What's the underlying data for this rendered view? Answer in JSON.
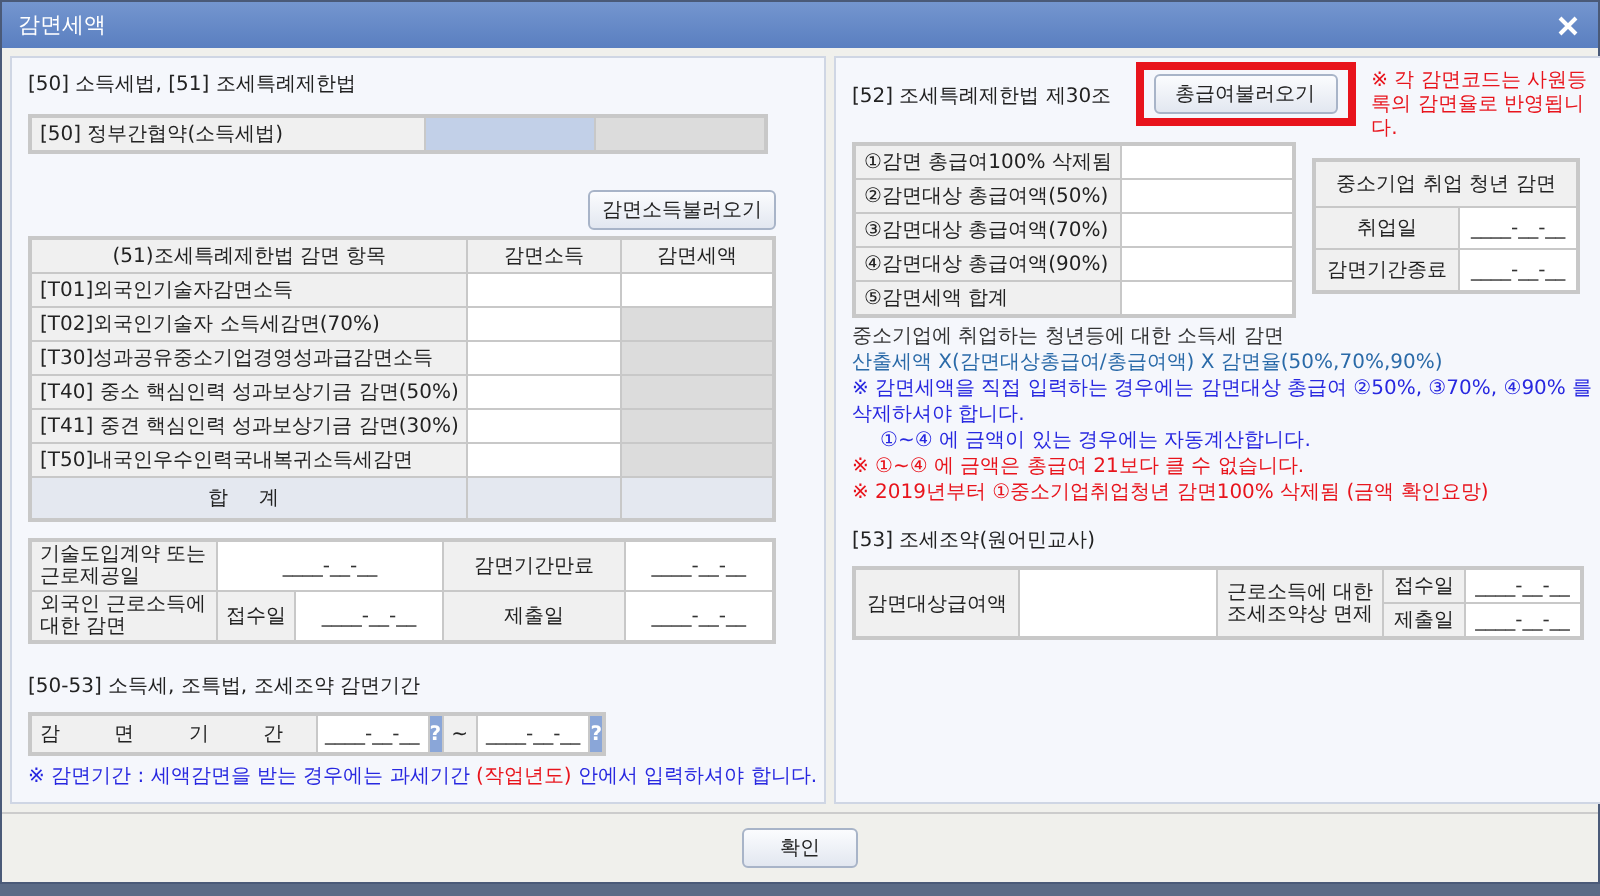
{
  "window": {
    "title": "감면세액"
  },
  "left": {
    "section_title": "[50] 소득세법, [51] 조세특례제한법",
    "treaty": {
      "label": "[50] 정부간협약(소득세법)"
    },
    "load_button": "감면소득불러오기",
    "table": {
      "columns": [
        "(51)조세특례제한법 감면 항목",
        "감면소득",
        "감면세액"
      ],
      "rows": [
        {
          "label": "[T01]외국인기술자감면소득",
          "tax_editable": true
        },
        {
          "label": "[T02]외국인기술자 소득세감면(70%)",
          "tax_editable": false
        },
        {
          "label": "[T30]성과공유중소기업경영성과급감면소득",
          "tax_editable": false
        },
        {
          "label": "[T40] 중소 핵심인력 성과보상기금 감면(50%)",
          "tax_editable": false
        },
        {
          "label": "[T41] 중견 핵심인력 성과보상기금 감면(30%)",
          "tax_editable": false
        },
        {
          "label": "[T50]내국인우수인력국내복귀소득세감면",
          "tax_editable": false
        }
      ],
      "total_label": "합 계"
    },
    "dates": {
      "contract_label": "기술도입계약 또는 근로제공일",
      "contract_date": "____-__-__",
      "expiry_label": "감면기간만료",
      "expiry_date": "____-__-__",
      "foreign_label": "외국인 근로소득에 대한 감면",
      "received_label": "접수일",
      "received_date": "____-__-__",
      "submitted_label": "제출일",
      "submitted_date": "____-__-__"
    },
    "period_title": "[50-53] 소득세, 조특법, 조세조약 감면기간",
    "period": {
      "label": "감 면 기 간",
      "from": "____-__-__",
      "help": "?",
      "tilde": "~",
      "to": "____-__-__"
    },
    "note": [
      {
        "text": "※ 감면기간 : 세액감면을 받는 경우에는 과세기간 ",
        "kind": "info"
      },
      {
        "text": "(작업년도)",
        "kind": "alert"
      },
      {
        "text": " 안에서 입력하셔야 합니다.",
        "kind": "info"
      }
    ]
  },
  "right": {
    "section_title": "[52] 조세특례제한법 제30조",
    "load_button": {
      "label": "총급여불러오기",
      "highlighted": true
    },
    "side_note": "※ 각 감면코드는 사원등록의 감면율로 반영됩니다.",
    "amounts": [
      "①감면 총급여100% 삭제됨",
      "②감면대상 총급여액(50%)",
      "③감면대상 총급여액(70%)",
      "④감면대상 총급여액(90%)",
      "⑤감면세액 합계"
    ],
    "youth": {
      "title": "중소기업 취업 청년 감면",
      "rows": [
        {
          "label": "취업일",
          "date": "____-__-__"
        },
        {
          "label": "감면기간종료",
          "date": "____-__-__"
        }
      ]
    },
    "notes": [
      {
        "text": "중소기업에 취업하는 청년등에 대한 소득세 감면",
        "kind": "plain"
      },
      {
        "text": "산출세액 X(감면대상총급여/총급여액) X 감면율(50%,70%,90%)",
        "kind": "formula"
      },
      {
        "text": "※ 감면세액을 직접 입력하는 경우에는 감면대상 총급여 ②50%, ③70%, ④90% 를 삭제하셔야 합니다.",
        "kind": "info"
      },
      {
        "text": "①~④ 에 금액이 있는 경우에는 자동계산합니다.",
        "kind": "indent"
      },
      {
        "text": "※ ①~④ 에 금액은 총급여 21보다 클 수 없습니다.",
        "kind": "alert"
      },
      {
        "text": "※ 2019년부터 ①중소기업취업청년 감면100% 삭제됨 (금액 확인요망)",
        "kind": "alert"
      }
    ],
    "treaty_title": "[53] 조세조약(원어민교사)",
    "treaty": {
      "amount_label": "감면대상급여액",
      "exempt_label": "근로소득에 대한 조세조약상 면제",
      "received_label": "접수일",
      "received_date": "____-__-__",
      "submitted_label": "제출일",
      "submitted_date": "____-__-__"
    }
  },
  "ok_button": "확인"
}
